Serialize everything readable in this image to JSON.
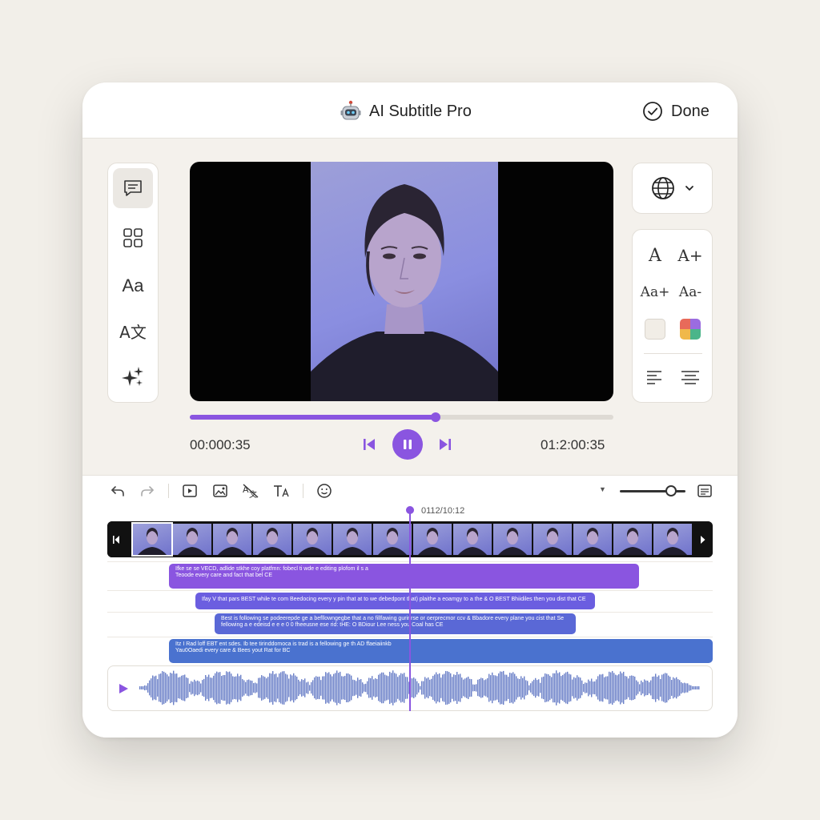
{
  "app": {
    "title": "AI Subtitle Pro",
    "done_label": "Done",
    "logo": "robot-icon"
  },
  "left_toolbar": {
    "items": [
      {
        "icon": "subtitles-icon",
        "label": "",
        "active": true
      },
      {
        "icon": "grid-icon",
        "label": ""
      },
      {
        "icon": "text-style-icon",
        "label": "Aa"
      },
      {
        "icon": "translate-icon",
        "label": "A文"
      },
      {
        "icon": "ai-sparkle-icon",
        "label": ""
      }
    ]
  },
  "player": {
    "current_time": "00:000:35",
    "total_time": "01:2:00:35",
    "progress": 0.58,
    "state": "playing"
  },
  "language_menu": {
    "icon": "globe-icon",
    "caret": "chevron-down-icon"
  },
  "style_panel": {
    "font_label": "A",
    "font_plus_label": "A+",
    "size_increase_label": "Aa+",
    "size_decrease_label": "Aa-",
    "swatches": [
      "#f1ede6",
      "multicolor"
    ],
    "align_icons": [
      "align-left-icon",
      "align-center-icon"
    ]
  },
  "timeline": {
    "playhead_time": "0112/10:12",
    "zoom": 0.78,
    "toolbar_icons": [
      "undo-icon",
      "redo-icon",
      "play-box-icon",
      "image-icon",
      "translate-off-icon",
      "text-size-icon",
      "emoji-icon",
      "captions-icon"
    ],
    "captions": [
      {
        "lines": [
          "Ifke  se se VECD, adlide stkhe coy platfmn: fobecl ti wde e editing plofom il s a",
          "Teoode every care and fact that bel CE"
        ],
        "color": "#8a55e0"
      },
      {
        "lines": [
          "Ifay V that pars BEST while te com Beedocing every y pin that at to we debedpont that) plaithe a eoamgy to a the & O BEST Bhiidiles then you dist that CE"
        ],
        "color": "#6b5ee0"
      },
      {
        "lines": [
          "Best is following se podeerepde ge a befllowngegbe that a no fillfawing gurinrse or oerprecmor ccv & Bbadore every plane you cist that Se",
          "fellowing a e edeisd e e e 0 0 fheeusne ese rid: tHE: O BDiour Lee ness you Coal has CE"
        ],
        "color": "#5a68d6"
      },
      {
        "lines": [
          "Itz I Rad loff EBT ent sdes. Ib tee tirinddomoca is trad is a fellowing ge th AD ffaeiaiinkb",
          "Yau0Oaedi every care & Bees yout Rat for BC"
        ],
        "color": "#4a72cf"
      }
    ]
  }
}
